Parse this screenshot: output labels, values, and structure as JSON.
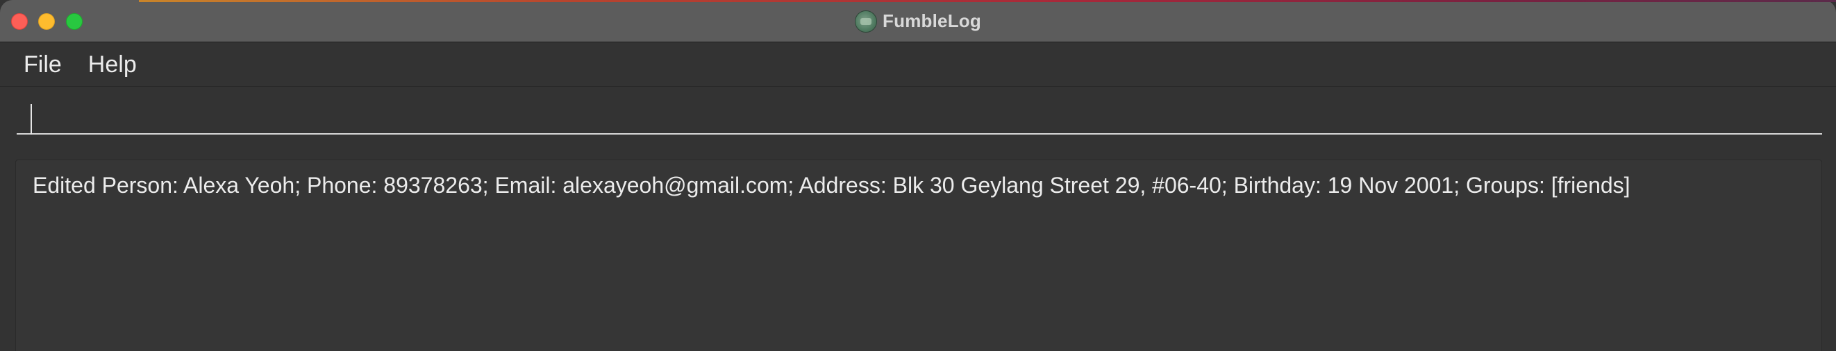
{
  "window": {
    "title": "FumbleLog"
  },
  "menubar": {
    "items": [
      {
        "label": "File"
      },
      {
        "label": "Help"
      }
    ]
  },
  "command_box": {
    "value": "",
    "placeholder": ""
  },
  "result_display": {
    "text": "Edited Person: Alexa Yeoh; Phone: 89378263; Email: alexayeoh@gmail.com; Address: Blk 30 Geylang Street 29, #06-40; Birthday: 19 Nov 2001; Groups: [friends]"
  },
  "colors": {
    "close": "#fe5f57",
    "minimize": "#febc2e",
    "zoom": "#28c840",
    "background": "#333333",
    "text": "#ececec"
  }
}
